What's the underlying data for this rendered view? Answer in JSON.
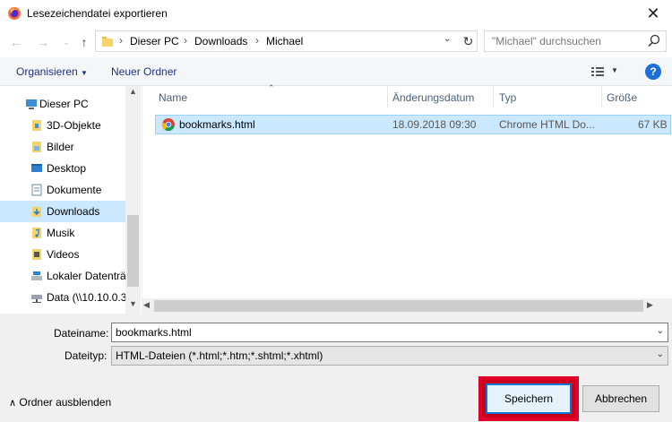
{
  "window": {
    "title": "Lesezeichendatei exportieren"
  },
  "address": {
    "crumbs": [
      "Dieser PC",
      "Downloads",
      "Michael"
    ]
  },
  "search": {
    "placeholder": "\"Michael\" durchsuchen"
  },
  "toolbar": {
    "organize": "Organisieren",
    "new_folder": "Neuer Ordner",
    "help": "?"
  },
  "nav": {
    "items": [
      {
        "label": "Dieser PC",
        "icon": "pc-icon"
      },
      {
        "label": "3D-Objekte",
        "icon": "3d-objects-icon"
      },
      {
        "label": "Bilder",
        "icon": "pictures-icon"
      },
      {
        "label": "Desktop",
        "icon": "desktop-icon"
      },
      {
        "label": "Dokumente",
        "icon": "documents-icon"
      },
      {
        "label": "Downloads",
        "icon": "downloads-icon",
        "selected": true
      },
      {
        "label": "Musik",
        "icon": "music-icon"
      },
      {
        "label": "Videos",
        "icon": "videos-icon"
      },
      {
        "label": "Lokaler Datenträ",
        "icon": "local-drive-icon"
      },
      {
        "label": "Data (\\\\10.10.0.3",
        "icon": "network-drive-icon"
      }
    ]
  },
  "filelist": {
    "columns": [
      "Name",
      "Änderungsdatum",
      "Typ",
      "Größe"
    ],
    "rows": [
      {
        "name": "bookmarks.html",
        "modified": "18.09.2018 09:30",
        "type": "Chrome HTML Do...",
        "size": "67 KB"
      }
    ]
  },
  "fields": {
    "filename_label": "Dateiname:",
    "filename_value": "bookmarks.html",
    "filetype_label": "Dateityp:",
    "filetype_value": "HTML-Dateien (*.html;*.htm;*.shtml;*.xhtml)"
  },
  "footer": {
    "hide_folders": "Ordner ausblenden",
    "save": "Speichern",
    "cancel": "Abbrechen"
  },
  "colors": {
    "accent": "#0078d7",
    "selection": "#cce8ff",
    "highlight_frame": "#e0002a"
  }
}
